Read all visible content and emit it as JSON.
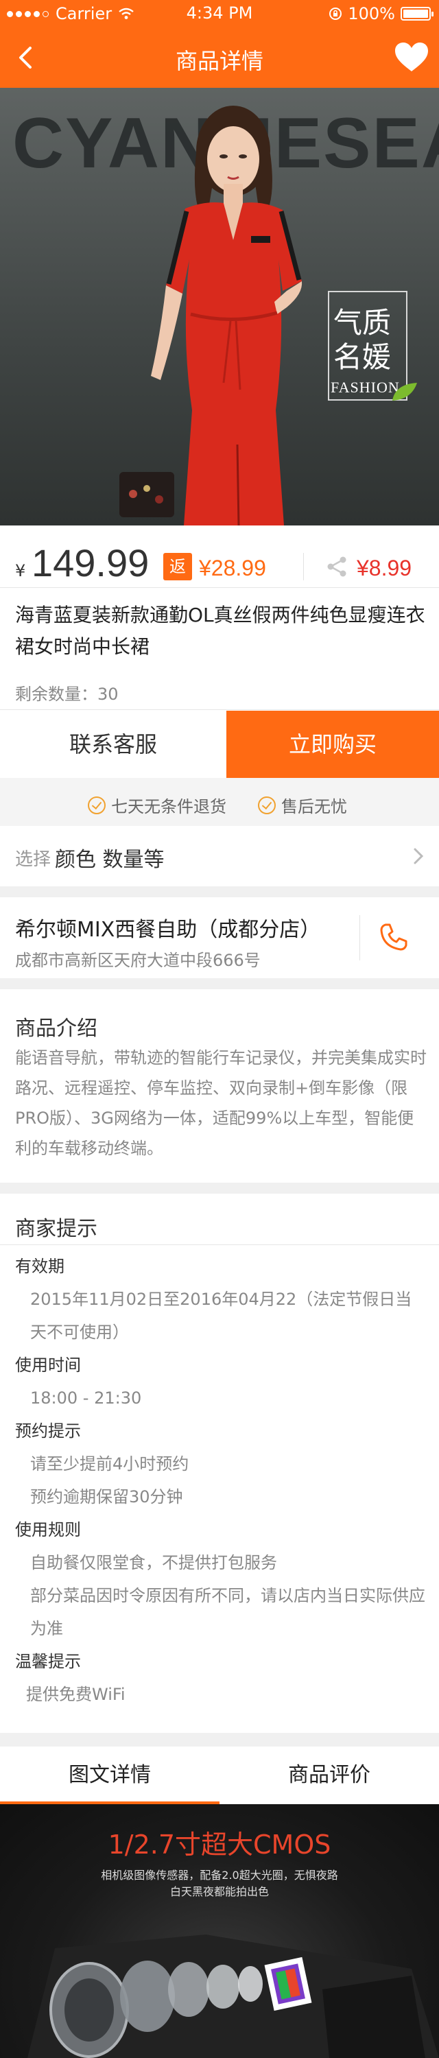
{
  "status_bar": {
    "carrier": "Carrier",
    "time": "4:34 PM",
    "battery": "100%"
  },
  "nav": {
    "title": "商品详情",
    "back_icon": "chevron-left-icon",
    "favorite_icon": "heart-icon"
  },
  "hero": {
    "brand_text": "CYANMESEA",
    "stamp_title": "气质\n名媛",
    "stamp_subtitle": "FASHION"
  },
  "price": {
    "currency": "¥",
    "current": "149.99",
    "rebate_tag": "返",
    "rebate_value": "¥28.99",
    "share_value": "¥8.99"
  },
  "product": {
    "name": "海青蓝夏装新款通勤OL真丝假两件纯色显瘦连衣裙女时尚中长裙",
    "stock": "剩余数量：30"
  },
  "actions": {
    "contact": "联系客服",
    "buy": "立即购买"
  },
  "guarantees": [
    "七天无条件退货",
    "售后无忧"
  ],
  "select": {
    "label": "选择",
    "value": "颜色 数量等"
  },
  "store": {
    "name": "希尔顿MIX西餐自助（成都分店）",
    "address": "成都市高新区天府大道中段666号"
  },
  "intro": {
    "title": "商品介绍",
    "text": "能语音导航，带轨迹的智能行车记录仪，并完美集成实时路况、远程遥控、停车监控、双向录制+倒车影像（限PRO版）、3G网络为一体，适配99%以上车型，智能便利的车载移动终端。"
  },
  "merchant_tips": {
    "title": "商家提示",
    "sections": [
      {
        "head": "有效期",
        "lines": [
          "2015年11月02日至2016年04月22（法定节假日当天不可使用）"
        ]
      },
      {
        "head": "使用时间",
        "lines": [
          "18:00 - 21:30"
        ]
      },
      {
        "head": "预约提示",
        "lines": [
          "请至少提前4小时预约",
          "预约逾期保留30分钟"
        ]
      },
      {
        "head": "使用规则",
        "lines": [
          "自助餐仅限堂食，不提供打包服务",
          "部分菜品因时令原因有所不同，请以店内当日实际供应为准"
        ]
      },
      {
        "head": "温馨提示",
        "lines": [
          "提供免费WiFi"
        ]
      }
    ]
  },
  "tabs": {
    "detail": "图文详情",
    "reviews": "商品评价"
  },
  "promo": {
    "headline": "1/2.7寸超大CMOS",
    "sub1": "相机级图像传感器，配备2.0超大光圈，无惧夜路",
    "sub2": "白天黑夜都能拍出色"
  },
  "colors": {
    "accent": "#ff6a13",
    "share_red": "#e8332b",
    "check_orange": "#f1a230"
  }
}
